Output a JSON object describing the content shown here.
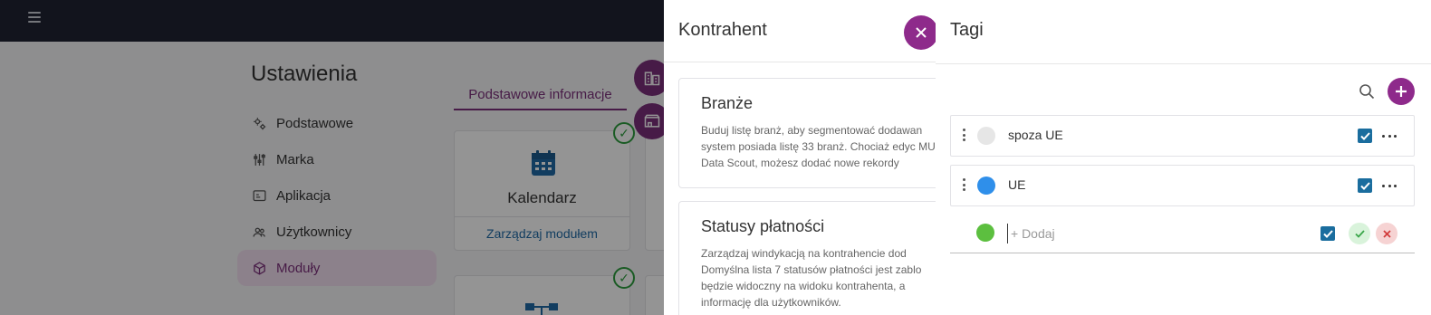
{
  "app": {
    "page_title": "Ustawienia",
    "menu": [
      {
        "label": "Podstawowe",
        "icon": "settings-gears-icon"
      },
      {
        "label": "Marka",
        "icon": "sliders-icon"
      },
      {
        "label": "Aplikacja",
        "icon": "app-window-icon"
      },
      {
        "label": "Użytkownicy",
        "icon": "users-icon"
      },
      {
        "label": "Moduły",
        "icon": "cube-icon",
        "active": true
      }
    ],
    "tab_label": "Podstawowe informacje",
    "modules": [
      {
        "title": "Kalendarz",
        "link": "Zarządzaj modułem",
        "icon": "calendar-icon",
        "enabled": true
      }
    ]
  },
  "kontrahent_drawer": {
    "title": "Kontrahent",
    "sections": [
      {
        "title": "Branże",
        "description": "Buduj listę branż, aby segmentować dodawan system posiada listę 33 branż. Chociaż edyc MUS Data Scout, możesz dodać nowe rekordy"
      },
      {
        "title": "Statusy płatności",
        "description": "Zarządzaj windykacją na kontrahencie dod Domyślna lista 7 statusów płatności jest zablo będzie widoczny na widoku kontrahenta, a informację dla użytkowników."
      }
    ]
  },
  "tags_drawer": {
    "title": "Tagi",
    "tags": [
      {
        "label": "spoza UE",
        "color": "#e6e6e6",
        "checked": true
      },
      {
        "label": "UE",
        "color": "#2f8fea",
        "checked": true
      }
    ],
    "new_tag": {
      "placeholder": "+ Dodaj",
      "value": "",
      "color": "#5cbf3f",
      "checked": true
    }
  },
  "colors": {
    "topbar": "#1f2433",
    "accent": "#8e2a8b",
    "link": "#1f6aa5",
    "checkbox": "#1a6d9e",
    "success": "#2e9e3e",
    "danger": "#d23c3c"
  }
}
